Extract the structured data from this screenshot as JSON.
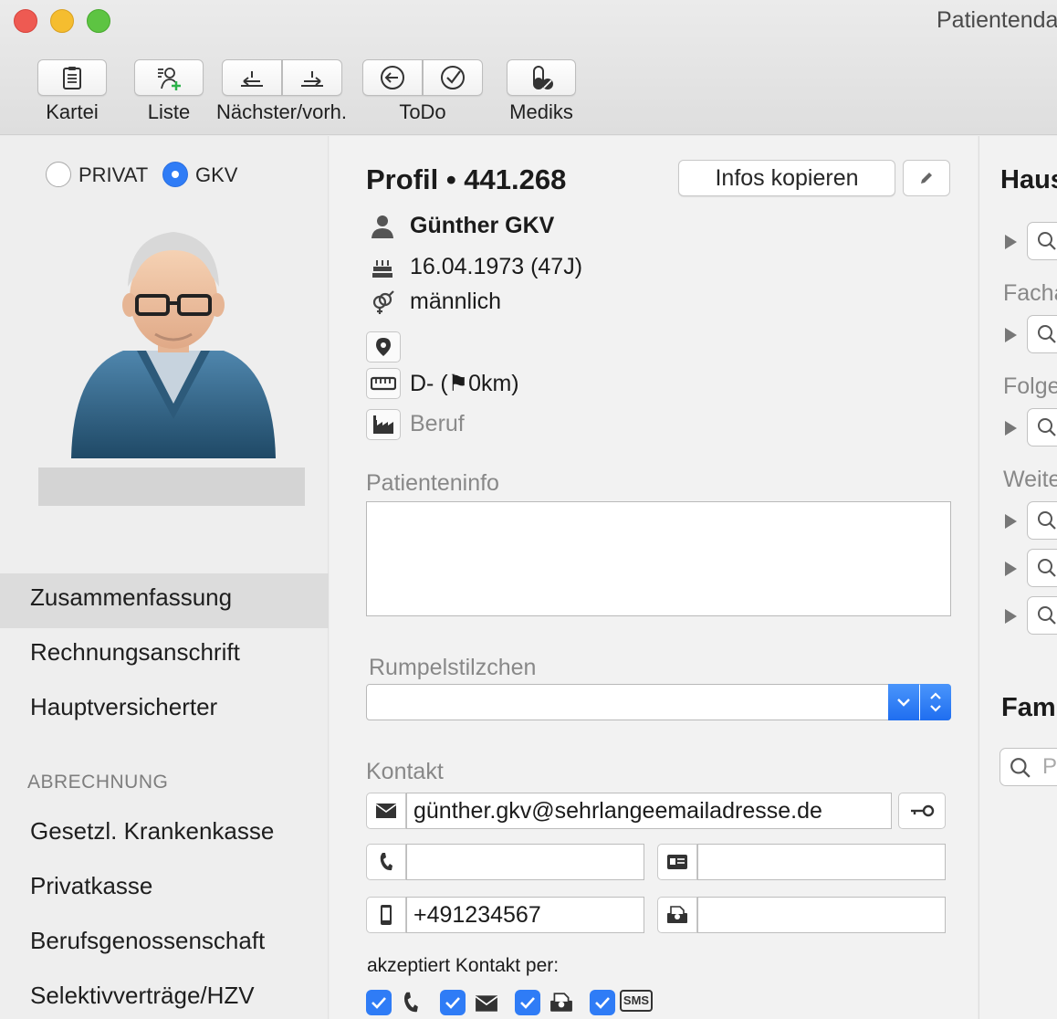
{
  "window": {
    "title": "Patientendaten"
  },
  "toolbar": {
    "kartei": "Kartei",
    "liste": "Liste",
    "naechster": "Nächster/vorh.",
    "todo": "ToDo",
    "mediks": "Mediks"
  },
  "sidebar": {
    "insurance": {
      "privat": "PRIVAT",
      "gkv": "GKV",
      "selected": "GKV"
    },
    "nav": [
      "Zusammenfassung",
      "Rechnungsanschrift",
      "Hauptversicherter"
    ],
    "section": "ABRECHNUNG",
    "billing": [
      "Gesetzl. Krankenkasse",
      "Privatkasse",
      "Berufsgenossenschaft",
      "Selektivverträge/HZV"
    ]
  },
  "profile": {
    "title": "Profil • 441.268",
    "copy_button": "Infos kopieren",
    "name": "Günther GKV",
    "birth": "16.04.1973 (47J)",
    "gender": "männlich",
    "distance": "D- (⚑0km)",
    "job": "Beruf"
  },
  "patientinfo": {
    "label": "Patienteninfo"
  },
  "rumpel": {
    "label": "Rumpelstilzchen"
  },
  "kontakt": {
    "label": "Kontakt",
    "email": "günther.gkv@sehrlangeemailadresse.de",
    "mobile": "+491234567",
    "accept_label": "akzeptiert Kontakt per:",
    "sms_label": "SMS"
  },
  "right": {
    "haus": "Haus",
    "fach": "Facha",
    "folge": "Folge",
    "weiter": "Weite",
    "fam": "Fam",
    "search_placeholder": "P"
  },
  "colors": {
    "accent": "#2f7cf6",
    "sidebar_active": "#dcdcdc"
  }
}
